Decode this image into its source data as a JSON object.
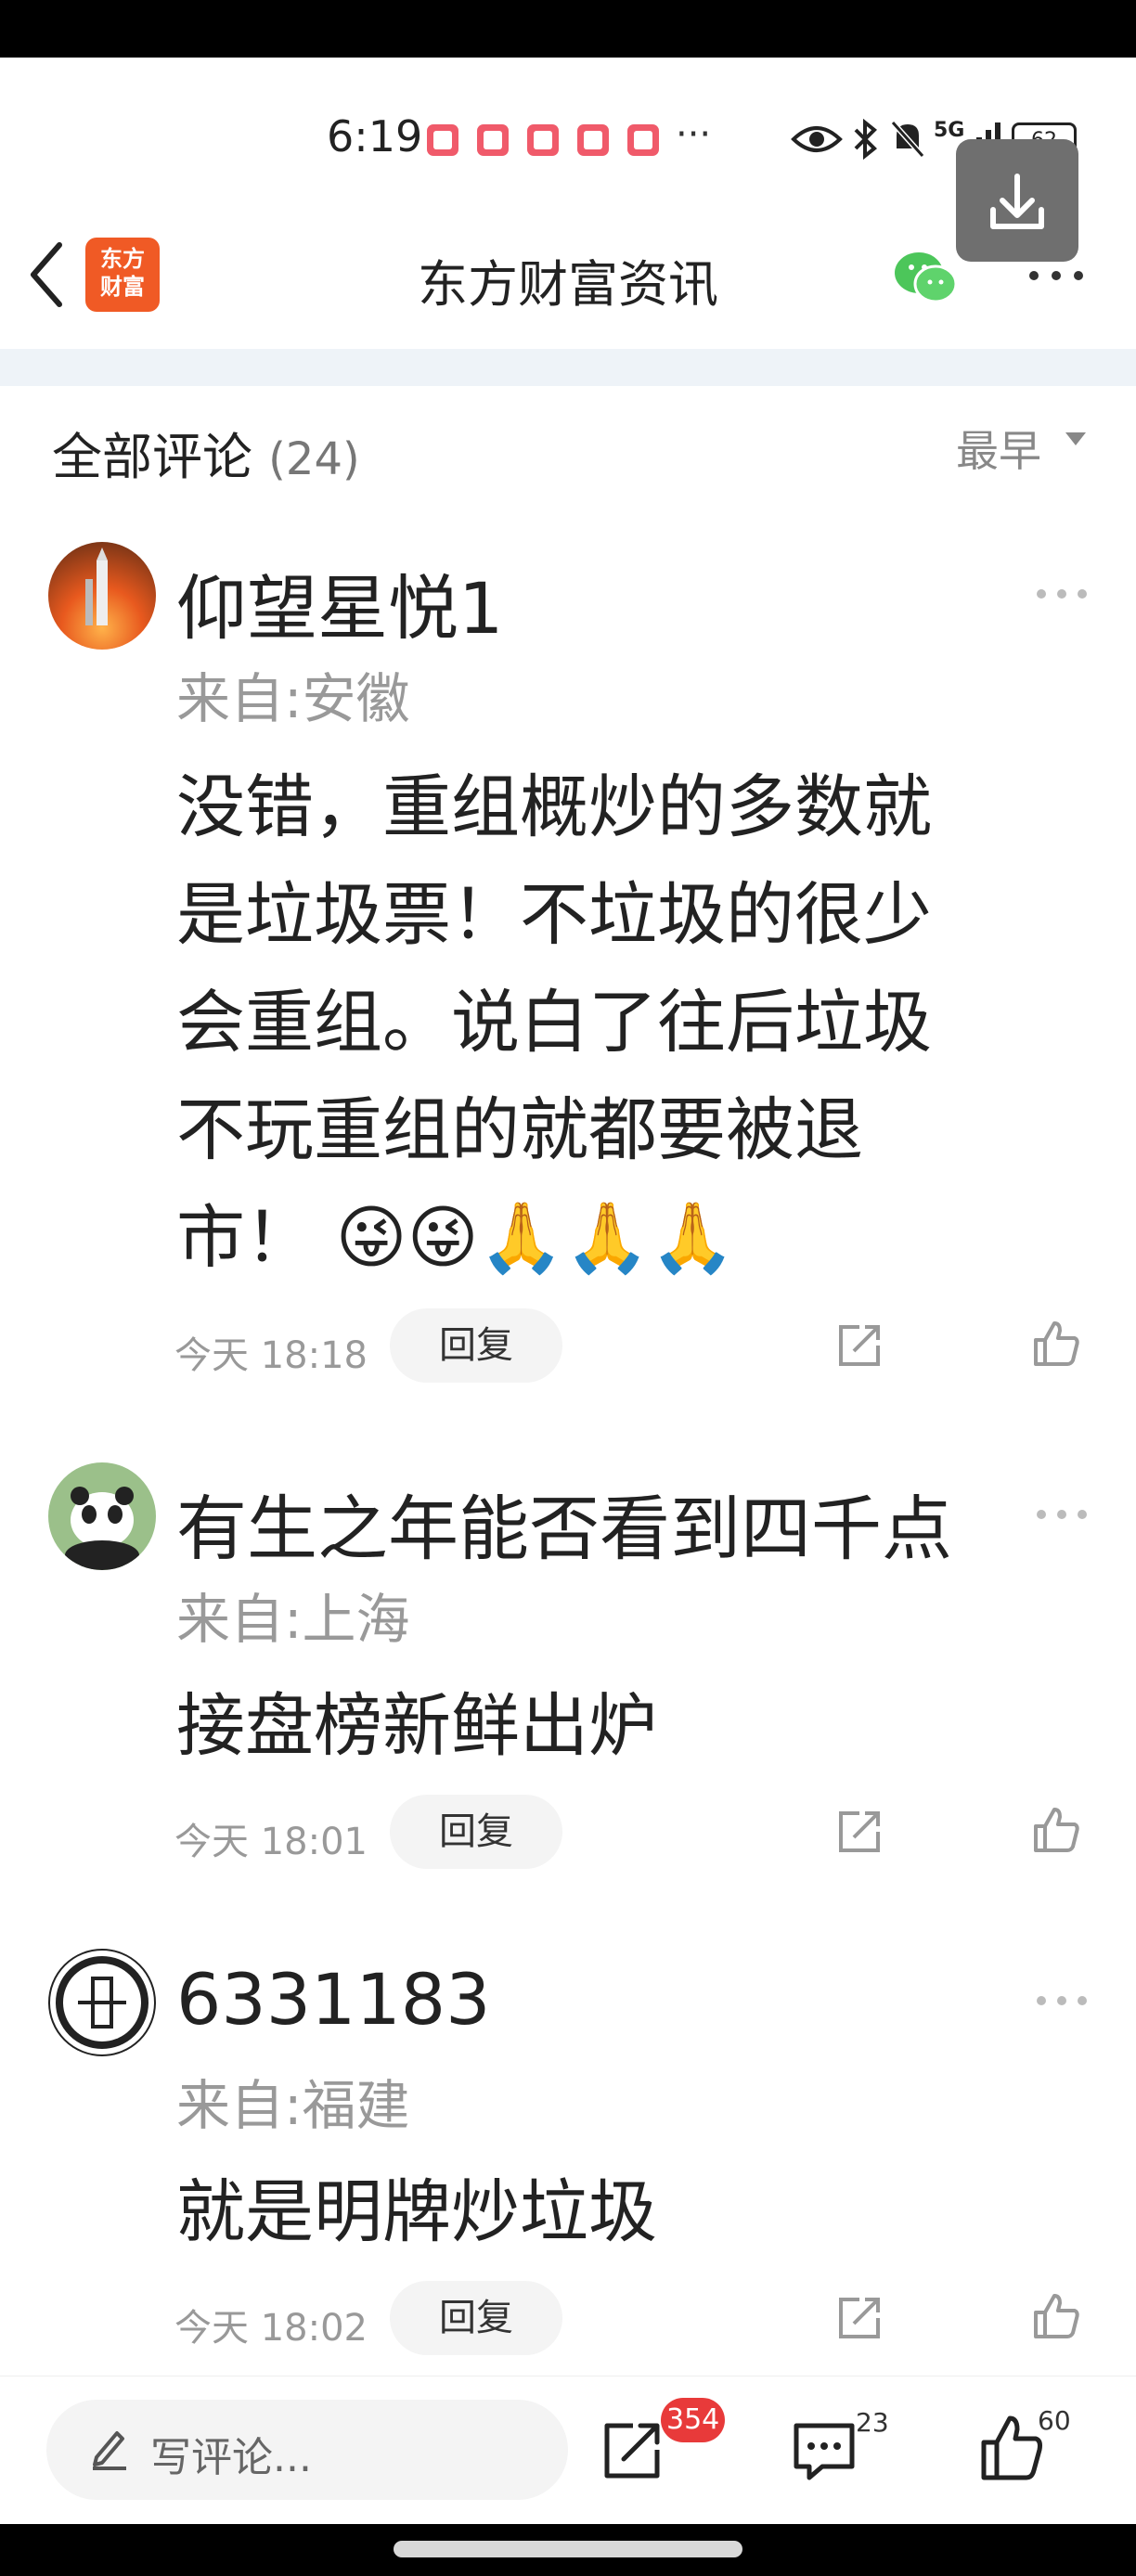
{
  "status_bar": {
    "time": "6:19",
    "overflow": "···",
    "icons": [
      "eye-icon",
      "bluetooth-icon",
      "mute-icon",
      "5g-signal-icon",
      "battery-icon"
    ],
    "network": "5G",
    "battery": "62"
  },
  "header": {
    "logo_text_line1": "东方",
    "logo_text_line2": "财富",
    "title": "东方财富资讯"
  },
  "comments_section": {
    "title": "全部评论",
    "count": "(24)",
    "sort": "最早"
  },
  "comments": [
    {
      "username": "仰望星悦1",
      "location": "来自:安徽",
      "lines": [
        "没错，重组概炒的多数就",
        "是垃圾票！不垃圾的很少",
        "会重组。说白了往后垃圾",
        "不玩重组的就都要被退",
        "市！ 😜😜🙏🙏🙏"
      ],
      "time": "今天 18:18",
      "reply": "回复"
    },
    {
      "username": "有生之年能否看到四千点",
      "location": "来自:上海",
      "lines": [
        "接盘榜新鲜出炉"
      ],
      "time": "今天 18:01",
      "reply": "回复"
    },
    {
      "username": "6331183",
      "location": "来自:福建",
      "lines": [
        "就是明牌炒垃圾"
      ],
      "time": "今天 18:02",
      "reply": "回复"
    }
  ],
  "bottom_bar": {
    "input_placeholder": "写评论...",
    "share_count": "354",
    "comment_count": "23",
    "like_count": "60"
  },
  "colors": {
    "accent_orange": "#f05a25",
    "badge_red": "#e83a3a",
    "wechat_green": "#4cc65a"
  }
}
